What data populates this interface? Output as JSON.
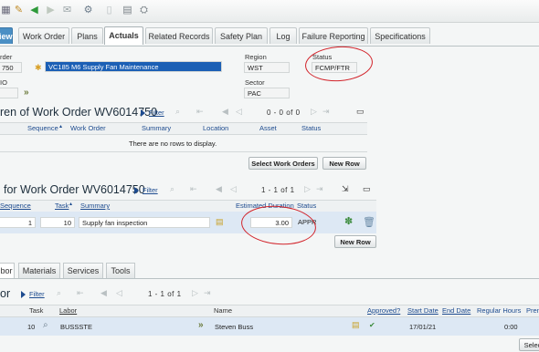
{
  "tabs": {
    "view": "iew",
    "work_order": "Work Order",
    "plans": "Plans",
    "actuals": "Actuals",
    "related_records": "Related Records",
    "safety_plan": "Safety Plan",
    "log": "Log",
    "failure_reporting": "Failure Reporting",
    "specifications": "Specifications"
  },
  "header": {
    "work_order_label": "rder",
    "work_order_value": "750",
    "description_value": "VC185 M6 Supply Fan Maintenance",
    "second_label": "IO",
    "region_label": "Region",
    "region_value": "WST",
    "sector_label": "Sector",
    "sector_value": "PAC",
    "status_label": "Status",
    "status_value": "FCMP/FTR"
  },
  "children": {
    "title": "ren of Work Order WV6014750",
    "filter": "Filter",
    "pager": "0 - 0 of 0",
    "columns": [
      "Sequence",
      "Work Order",
      "Summary",
      "Location",
      "Asset",
      "Status"
    ],
    "empty_text": "There are no rows to display.",
    "select_btn": "Select Work Orders",
    "new_row_btn": "New Row"
  },
  "tasks": {
    "title": "for Work Order WV6014750",
    "filter": "Filter",
    "pager": "1 - 1 of 1",
    "columns": [
      "Sequence",
      "Task",
      "Summary",
      "Estimated Duration",
      "Status"
    ],
    "row": {
      "sequence": "1",
      "task": "10",
      "summary": "Supply fan inspection",
      "duration": "3.00",
      "status": "APPR"
    },
    "new_row_btn": "New Row"
  },
  "subtabs": {
    "labor": "bor",
    "materials": "Materials",
    "services": "Services",
    "tools": "Tools"
  },
  "labor": {
    "title": "or",
    "filter": "Filter",
    "pager": "1 - 1 of 1",
    "columns": [
      "Task",
      "Labor",
      "Name",
      "Approved?",
      "Start Date",
      "End Date",
      "Regular Hours",
      "Prem"
    ],
    "row": {
      "task": "10",
      "labor": "BUSSSTE",
      "name": "Steven Buss",
      "start_date": "17/01/21",
      "regular_hours": "0:00"
    },
    "select_btn": "Selec"
  },
  "colors": {
    "accent": "#1d4b8f",
    "annotation": "#d2232a",
    "selected_field": "#1b5fb5"
  }
}
